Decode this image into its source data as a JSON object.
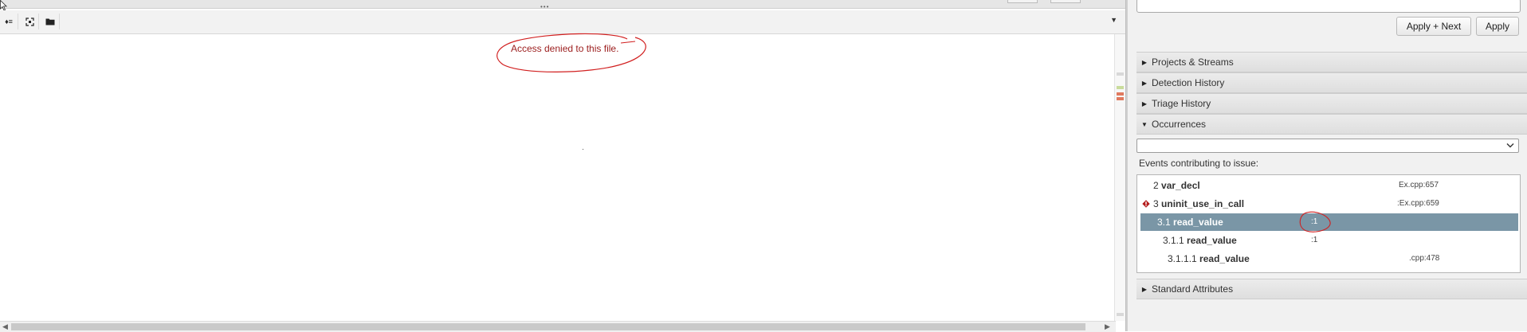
{
  "editor": {
    "toolbar": {
      "buttons": [
        {
          "icon": "list-toggle-icon",
          "glyph": "♦≡"
        },
        {
          "icon": "expand-icon",
          "glyph": "⛶"
        },
        {
          "icon": "folder-icon",
          "glyph": "■"
        }
      ],
      "dropdown_glyph": "▼"
    },
    "top_grip": "•••",
    "message": "Access denied to this file.",
    "scroll_left_glyph": "◀",
    "scroll_right_glyph": "▶"
  },
  "details": {
    "apply_next_label": "Apply + Next",
    "apply_label": "Apply",
    "sections": {
      "projects": "Projects & Streams",
      "detection": "Detection History",
      "triage": "Triage History",
      "occurrences": "Occurrences",
      "standard": "Standard Attributes"
    },
    "collapsed_glyph": "▶",
    "expanded_glyph": "▼",
    "occurrences_select_value": "",
    "select_chevron": "⌄",
    "events_label": "Events contributing to issue:",
    "events": [
      {
        "num": "2",
        "name": "var_decl",
        "location": "Ex.cpp:657",
        "selected": false,
        "error": false
      },
      {
        "num": "3",
        "name": "uninit_use_in_call",
        "location": ":Ex.cpp:659",
        "selected": false,
        "error": true
      },
      {
        "num": "3.1",
        "name": "read_value",
        "location": ":1",
        "selected": true,
        "error": false
      },
      {
        "num": "3.1.1",
        "name": "read_value",
        "location": ":1",
        "selected": false,
        "error": false
      },
      {
        "num": "3.1.1.1",
        "name": "read_value",
        "location": ".cpp:478",
        "selected": false,
        "error": false
      }
    ]
  },
  "colors": {
    "annotation_red": "#d11f1f",
    "selected_row": "#7a96a6",
    "error_icon": "#b31b1b"
  }
}
